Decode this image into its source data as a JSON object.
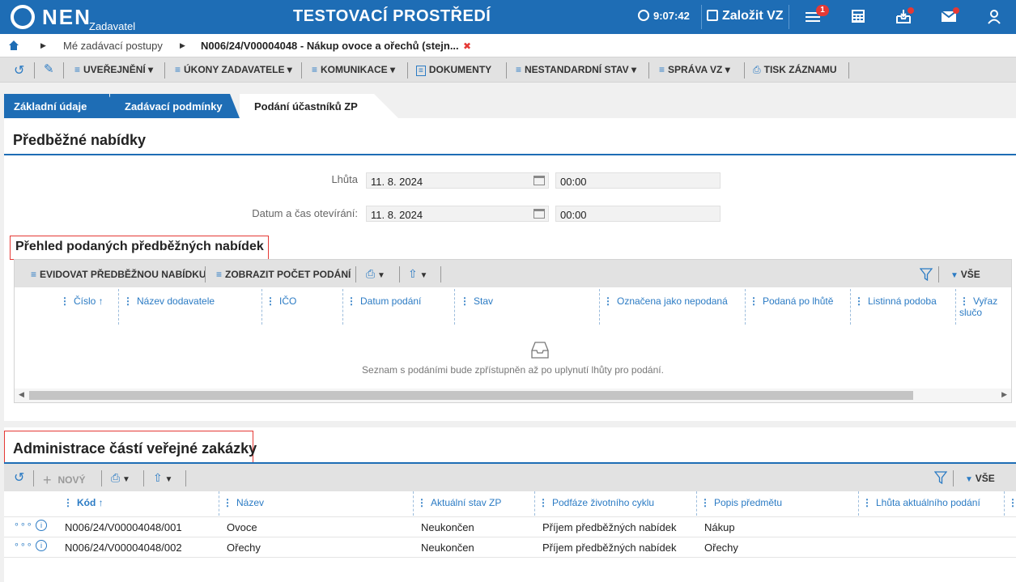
{
  "header": {
    "logo": "NEN",
    "logo_sub": "Zadavatel",
    "env_title": "TESTOVACÍ PROSTŘEDÍ",
    "clock": "9:07:42",
    "create_vz": "Založit VZ",
    "menu_badge": "1"
  },
  "breadcrumb": {
    "item1": "Mé zadávací postupy",
    "item2": "N006/24/V00004048 - Nákup ovoce a ořechů (stejn...",
    "close_glyph": "✖"
  },
  "toolbar": {
    "uverejneni": "UVEŘEJNĚNÍ",
    "ukony": "ÚKONY ZADAVATELE",
    "komunikace": "KOMUNIKACE",
    "dokumenty": "DOKUMENTY",
    "nestandardni": "NESTANDARDNÍ STAV",
    "sprava": "SPRÁVA VZ",
    "tisk": "TISK ZÁZNAMU"
  },
  "tabs": [
    "Základní údaje",
    "Zadávací podmínky",
    "Podání účastníků ZP"
  ],
  "prebid": {
    "title": "Předběžné nabídky",
    "lhuta_label": "Lhůta",
    "lhuta_date": "11. 8. 2024",
    "lhuta_time": "00:00",
    "otevreni_label": "Datum a čas otevírání:",
    "otevreni_date": "11. 8. 2024",
    "otevreni_time": "00:00",
    "subtitle": "Přehled podaných předběžných nabídek",
    "btn_evidovat": "EVIDOVAT PŘEDBĚŽNOU NABÍDKU",
    "btn_pocet": "ZOBRAZIT POČET PODÁNÍ",
    "vse": "VŠE",
    "columns": [
      "Číslo ↑",
      "Název dodavatele",
      "IČO",
      "Datum podání",
      "Stav",
      "Označena jako nepodaná",
      "Podaná po lhůtě",
      "Listinná podoba",
      "Vyřaz slučo"
    ],
    "empty_text": "Seznam s podáními bude zpřístupněn až po uplynutí lhůty pro podání."
  },
  "parts": {
    "title": "Administrace částí veřejné zakázky",
    "btn_new": "NOVÝ",
    "vse": "VŠE",
    "columns": [
      "Kód ↑",
      "Název",
      "Aktuální stav ZP",
      "Podfáze životního cyklu",
      "Popis předmětu",
      "Lhůta aktuálního podání"
    ],
    "rows": [
      {
        "kod": "N006/24/V00004048/001",
        "nazev": "Ovoce",
        "stav": "Neukončen",
        "podfaze": "Příjem předběžných nabídek",
        "popis": "Nákup"
      },
      {
        "kod": "N006/24/V00004048/002",
        "nazev": "Ořechy",
        "stav": "Neukončen",
        "podfaze": "Příjem předběžných nabídek",
        "popis": "Ořechy"
      }
    ]
  },
  "colors": {
    "brand": "#1e6db5",
    "accent_text": "#2b7bc4",
    "alert": "#e53935"
  }
}
